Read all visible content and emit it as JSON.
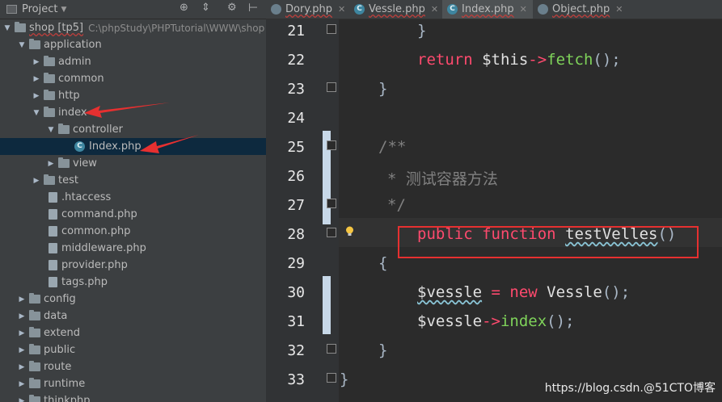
{
  "project_panel": {
    "title": "Project",
    "tree": [
      {
        "label": "shop [tp5]",
        "path": "C:\\phpStudy\\PHPTutorial\\WWW\\shop"
      },
      {
        "label": "application"
      },
      {
        "label": "admin"
      },
      {
        "label": "common"
      },
      {
        "label": "http"
      },
      {
        "label": "index"
      },
      {
        "label": "controller"
      },
      {
        "label": "Index.php"
      },
      {
        "label": "view"
      },
      {
        "label": "test"
      },
      {
        "label": ".htaccess"
      },
      {
        "label": "command.php"
      },
      {
        "label": "common.php"
      },
      {
        "label": "middleware.php"
      },
      {
        "label": "provider.php"
      },
      {
        "label": "tags.php"
      },
      {
        "label": "config"
      },
      {
        "label": "data"
      },
      {
        "label": "extend"
      },
      {
        "label": "public"
      },
      {
        "label": "route"
      },
      {
        "label": "runtime"
      },
      {
        "label": "thinkphp"
      }
    ]
  },
  "tabs": [
    {
      "label": "Dory.php",
      "icon": "php-file-icon",
      "active": false
    },
    {
      "label": "Vessle.php",
      "icon": "php-class-icon",
      "active": false
    },
    {
      "label": "Index.php",
      "icon": "php-class-icon",
      "active": true
    },
    {
      "label": "Object.php",
      "icon": "php-file-icon",
      "active": false
    }
  ],
  "editor": {
    "line_numbers": [
      "21",
      "22",
      "23",
      "24",
      "25",
      "26",
      "27",
      "28",
      "29",
      "30",
      "31",
      "32",
      "33"
    ],
    "lines": {
      "l21": "}",
      "l22_kw": "return",
      "l22_var": "$this",
      "l22_arrow": "->",
      "l22_fn": "fetch",
      "l22_tail": "();",
      "l23": "}",
      "l25": "/**",
      "l26_star": "* ",
      "l26_text": "测试容器方法",
      "l27": "*/",
      "l28_kw1": "public",
      "l28_kw2": "function",
      "l28_name": "testVelles",
      "l28_parens": "()",
      "l29": "{",
      "l30_var": "$vessle",
      "l30_eq": " = ",
      "l30_new": "new",
      "l30_cls": " Vessle",
      "l30_tail": "();",
      "l31_var": "$vessle",
      "l31_arrow": "->",
      "l31_fn": "index",
      "l31_tail": "();",
      "l32": "}",
      "l33": "}"
    }
  },
  "watermark": "https://blog.csdn.@51CTO博客",
  "colors": {
    "annotation_red": "#e63030",
    "keyword": "#ff4a6e",
    "method": "#ffc66d"
  }
}
